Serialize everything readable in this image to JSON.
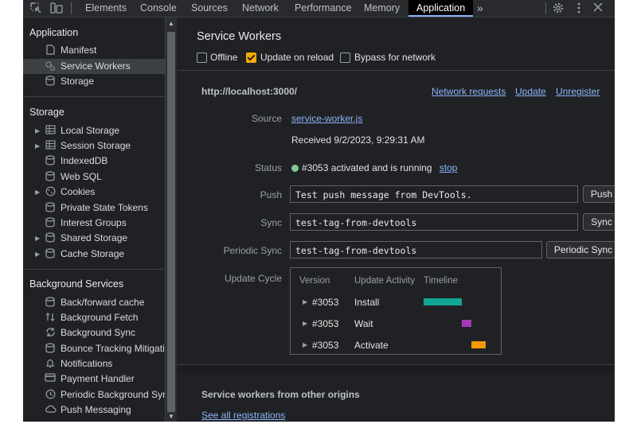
{
  "tabbar": {
    "tabs": [
      "Elements",
      "Console",
      "Sources",
      "Network",
      "Performance",
      "Memory",
      "Application"
    ],
    "more": "»",
    "left_icons": [
      "inspect-element-icon",
      "device-toolbar-icon"
    ],
    "right_icons": [
      "gear-icon",
      "more-vert-icon",
      "close-icon"
    ]
  },
  "sidebar": {
    "application": {
      "heading": "Application",
      "items": [
        {
          "label": "Manifest",
          "icon": "file-icon"
        },
        {
          "label": "Service Workers",
          "icon": "gears-icon"
        },
        {
          "label": "Storage",
          "icon": "database-icon"
        }
      ]
    },
    "storage": {
      "heading": "Storage",
      "items": [
        {
          "label": "Local Storage",
          "icon": "table-icon"
        },
        {
          "label": "Session Storage",
          "icon": "table-icon"
        },
        {
          "label": "IndexedDB",
          "icon": "database-icon"
        },
        {
          "label": "Web SQL",
          "icon": "database-icon"
        },
        {
          "label": "Cookies",
          "icon": "cookie-icon"
        },
        {
          "label": "Private State Tokens",
          "icon": "database-icon"
        },
        {
          "label": "Interest Groups",
          "icon": "database-icon"
        },
        {
          "label": "Shared Storage",
          "icon": "database-icon"
        },
        {
          "label": "Cache Storage",
          "icon": "database-icon"
        }
      ]
    },
    "background": {
      "heading": "Background Services",
      "items": [
        {
          "label": "Back/forward cache",
          "icon": "database-icon"
        },
        {
          "label": "Background Fetch",
          "icon": "sync-arrows-icon"
        },
        {
          "label": "Background Sync",
          "icon": "sync-icon"
        },
        {
          "label": "Bounce Tracking Mitigations",
          "icon": "database-icon"
        },
        {
          "label": "Notifications",
          "icon": "bell-icon"
        },
        {
          "label": "Payment Handler",
          "icon": "card-icon"
        },
        {
          "label": "Periodic Background Sync",
          "icon": "clock-icon"
        },
        {
          "label": "Push Messaging",
          "icon": "cloud-icon"
        }
      ]
    }
  },
  "main": {
    "title": "Service Workers",
    "options": {
      "offline": "Offline",
      "update_on_reload": "Update on reload",
      "bypass": "Bypass for network"
    },
    "origin": "http://localhost:3000/",
    "links": {
      "network_requests": "Network requests",
      "update": "Update",
      "unregister": "Unregister"
    },
    "source_label": "Source",
    "source_file": "service-worker.js",
    "received": "Received 9/2/2023, 9:29:31 AM",
    "status_label": "Status",
    "status_text": "#3053 activated and is running",
    "stop": "stop",
    "push_label": "Push",
    "push_value": "Test push message from DevTools.",
    "push_button": "Push",
    "sync_label": "Sync",
    "sync_value": "test-tag-from-devtools",
    "sync_button": "Sync",
    "periodic_label": "Periodic Sync",
    "periodic_value": "test-tag-from-devtools",
    "periodic_button": "Periodic Sync",
    "cycle_label": "Update Cycle",
    "cycle": {
      "headers": [
        "Version",
        "Update Activity",
        "Timeline"
      ],
      "rows": [
        {
          "version": "#3053",
          "activity": "Install",
          "color": "#12a593"
        },
        {
          "version": "#3053",
          "activity": "Wait",
          "color": "#a639b7"
        },
        {
          "version": "#3053",
          "activity": "Activate",
          "color": "#f29900"
        }
      ]
    },
    "other_origins": "Service workers from other origins",
    "see_all": "See all registrations"
  },
  "colors": {
    "accent": "#8ab4f8",
    "status_ok": "#81c995",
    "checkbox": "#f9ab00"
  }
}
